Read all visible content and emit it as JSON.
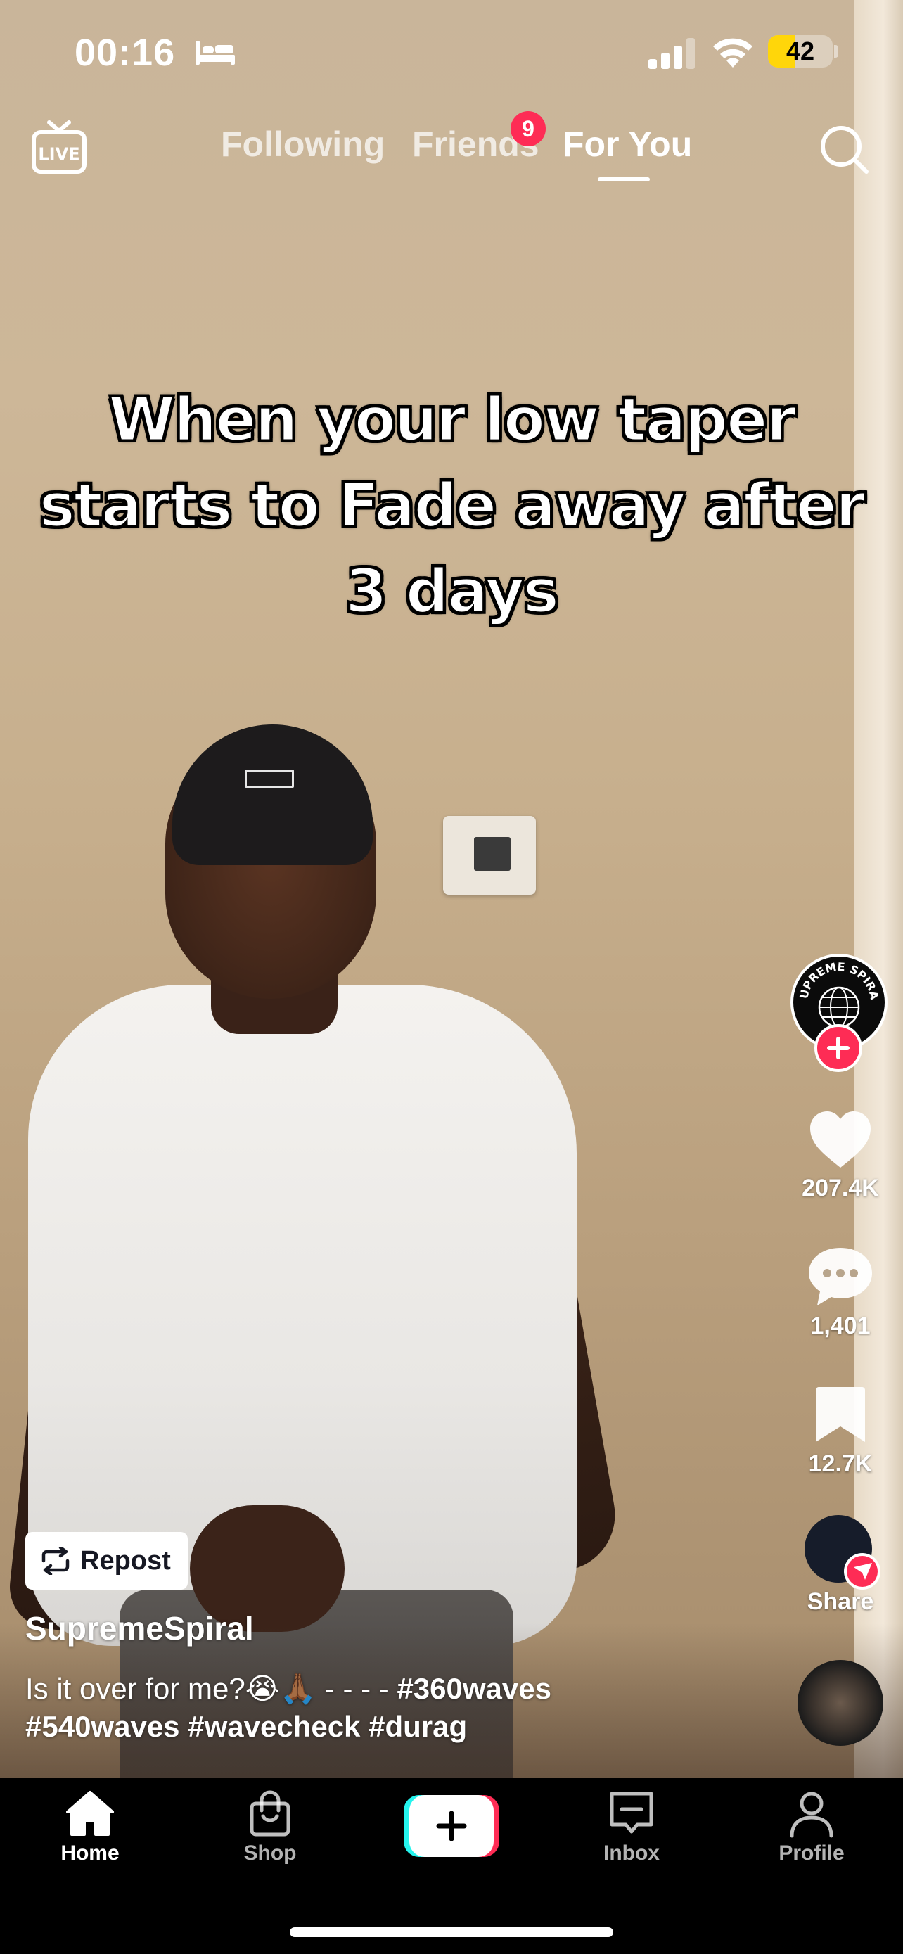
{
  "status_bar": {
    "time": "00:16",
    "battery_level": "42",
    "battery_fraction": 0.42,
    "icons": [
      "bed-icon",
      "signal-icon",
      "wifi-icon",
      "battery-icon"
    ]
  },
  "top_nav": {
    "live_label": "LIVE",
    "tabs": [
      {
        "label": "Following",
        "active": false
      },
      {
        "label": "Friends",
        "active": false,
        "badge": "9"
      },
      {
        "label": "For You",
        "active": true
      }
    ],
    "search_icon": "search-icon"
  },
  "video": {
    "overlay_text": "When your low taper starts to Fade away after 3 days"
  },
  "right_rail": {
    "avatar_text": "SUPREME SPIRAL",
    "likes": "207.4K",
    "comments": "1,401",
    "saves": "12.7K",
    "share_label": "Share"
  },
  "post": {
    "repost_label": "Repost",
    "creator": "SupremeSpiral",
    "caption_text": "Is it over for me?😭🙏🏾 - - - - ",
    "hashtags": [
      "#360waves",
      "#540waves",
      "#wavecheck",
      "#durag"
    ]
  },
  "tab_bar": {
    "home": "Home",
    "shop": "Shop",
    "inbox": "Inbox",
    "profile": "Profile"
  },
  "colors": {
    "accent": "#fe2c55",
    "cyan": "#25f4ee",
    "battery": "#ffd60a"
  }
}
